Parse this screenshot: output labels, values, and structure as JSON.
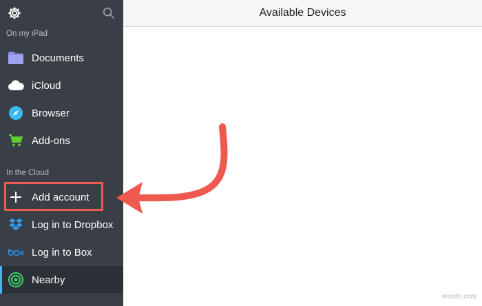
{
  "sidebar": {
    "sections": [
      {
        "label": "On my iPad"
      },
      {
        "label": "In the Cloud"
      }
    ],
    "items": [
      {
        "label": "Documents",
        "icon": "folder-icon"
      },
      {
        "label": "iCloud",
        "icon": "cloud-icon"
      },
      {
        "label": "Browser",
        "icon": "compass-icon"
      },
      {
        "label": "Add-ons",
        "icon": "cart-icon"
      },
      {
        "label": "Add account",
        "icon": "plus-icon"
      },
      {
        "label": "Log in to Dropbox",
        "icon": "dropbox-icon"
      },
      {
        "label": "Log in to Box",
        "icon": "box-icon"
      },
      {
        "label": "Nearby",
        "icon": "radar-icon",
        "active": true
      }
    ]
  },
  "main": {
    "title": "Available Devices"
  },
  "annotation": {
    "highlight_color": "#ee5a4f"
  },
  "watermark": "wsxdn.com",
  "colors": {
    "sidebar_bg": "#3a3e46",
    "folder": "#8a8fe6",
    "compass": "#3eb9f0",
    "cart": "#5fcf2e",
    "dropbox": "#2f9cf0",
    "box": "#2f8ee6",
    "nearby": "#3ed36b"
  }
}
